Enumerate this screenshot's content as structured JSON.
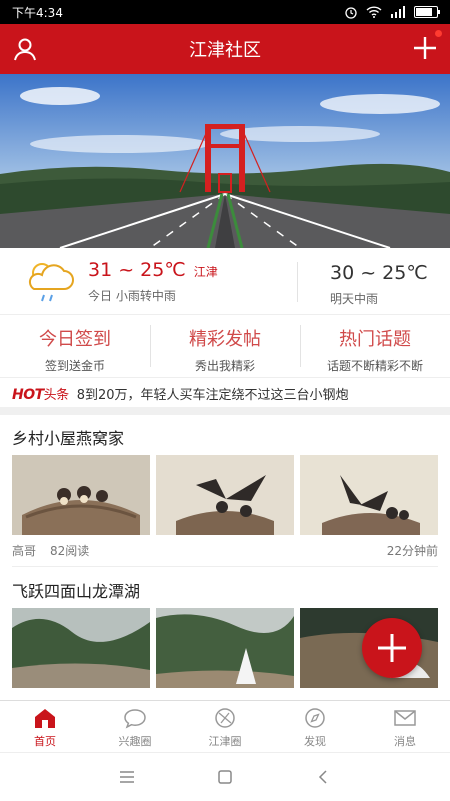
{
  "status": {
    "time": "下午4:34"
  },
  "header": {
    "title": "江津社区"
  },
  "weather": {
    "today": {
      "temp": "31 ~ 25℃",
      "city": "江津",
      "desc": "今日 小雨转中雨"
    },
    "tomorrow": {
      "temp": "30 ~ 25℃",
      "desc": "明天中雨"
    }
  },
  "quick": [
    {
      "title": "今日签到",
      "sub": "签到送金币"
    },
    {
      "title": "精彩发帖",
      "sub": "秀出我精彩"
    },
    {
      "title": "热门话题",
      "sub": "话题不断精彩不断"
    }
  ],
  "hot": {
    "logo": "HOT",
    "logo_suffix": "头条",
    "text": "8到20万，年轻人买车注定绕不过这三台小钢炮"
  },
  "posts": [
    {
      "title": "乡村小屋燕窝家",
      "author": "高哥",
      "reads": "82阅读",
      "time": "22分钟前"
    },
    {
      "title": "飞跃四面山龙潭湖"
    }
  ],
  "tabs": [
    {
      "label": "首页",
      "icon": "home-icon",
      "active": true
    },
    {
      "label": "兴趣圈",
      "icon": "chat-bubble-icon",
      "active": false
    },
    {
      "label": "江津圈",
      "icon": "circle-icon",
      "active": false
    },
    {
      "label": "发现",
      "icon": "compass-icon",
      "active": false
    },
    {
      "label": "消息",
      "icon": "mail-icon",
      "active": false
    }
  ],
  "colors": {
    "brand": "#c9141b"
  },
  "battery_level": 0.9
}
